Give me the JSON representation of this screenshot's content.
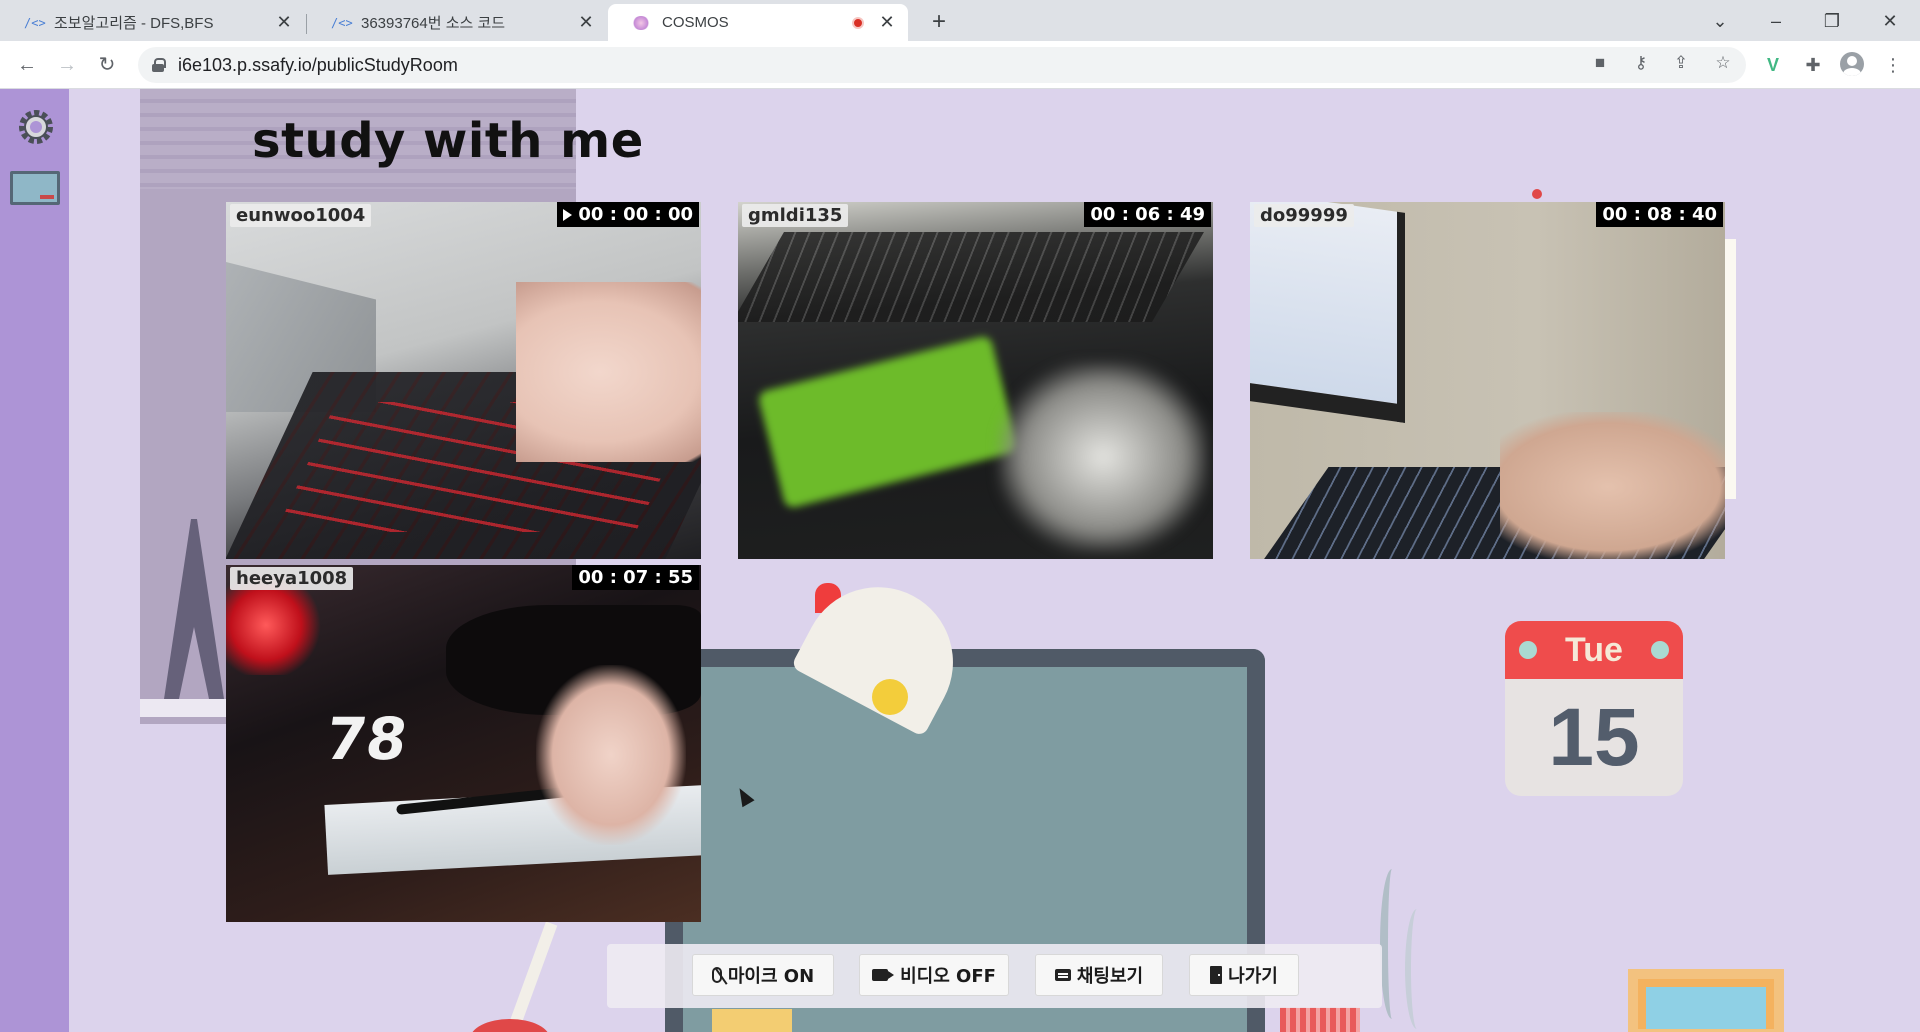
{
  "browser": {
    "tabs": [
      {
        "title": "조보알고리즘 - DFS,BFS",
        "icon": "code-icon",
        "active": false
      },
      {
        "title": "36393764번 소스 코드",
        "icon": "code-icon",
        "active": false
      },
      {
        "title": "COSMOS",
        "icon": "cosmos-icon",
        "active": true,
        "recording": true
      }
    ],
    "url": "i6e103.p.ssafy.io/publicStudyRoom"
  },
  "page": {
    "title": "study with me"
  },
  "participants": [
    {
      "username": "eunwoo1004",
      "timer": "00 : 00 : 00",
      "playing": true
    },
    {
      "username": "gmldi135",
      "timer": "00 : 06 : 49",
      "playing": false
    },
    {
      "username": "do99999",
      "timer": "00 : 08 : 40",
      "playing": false
    },
    {
      "username": "heeya1008",
      "timer": "00 : 07 : 55",
      "playing": false
    }
  ],
  "calendar": {
    "day": "Tue",
    "date": "15"
  },
  "feed_text": {
    "shirt_number": "78"
  },
  "controls": {
    "mic": "마이크 ON",
    "video": "비디오 OFF",
    "chat": "채팅보기",
    "leave": "나가기"
  },
  "colors": {
    "page_bg": "#dcd3ec",
    "sidebar": "#ad94d6",
    "record": "#d93025"
  }
}
